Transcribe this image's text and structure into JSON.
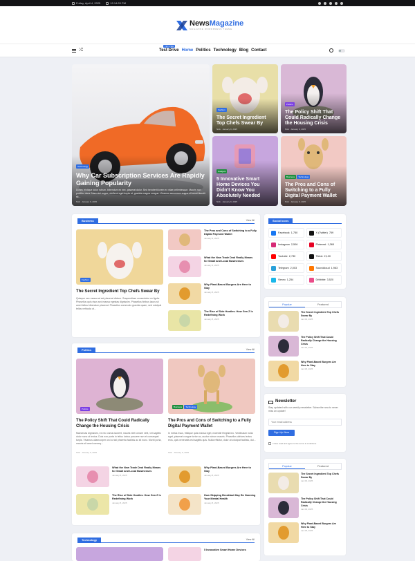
{
  "topbar": {
    "date": "Friday, April 4, 2025",
    "time": "12:14:20 PM"
  },
  "brand": {
    "name_a": "News",
    "name_b": "Magazine",
    "tagline": "MAGAZINE WORDPRESS THEME",
    "brand_color": "#2f6de1"
  },
  "nav": {
    "badge": "TRY PRO",
    "items": [
      "Test Drive",
      "Home",
      "Politics",
      "Technology",
      "Blog",
      "Contact"
    ],
    "active_index": 1
  },
  "hero": {
    "main": {
      "tag": "Technology",
      "title": "Why Car Subscription Services Are Rapidly Gaining Popularity",
      "excerpt": "Donec tristique dolor rutrum, bibendum ex nec, placerat dolor. Sed hendrerit lorem ex vitae pellentesque. Mauris non porttitor risus. Nam nisi augue, eleifend eget turpis ut, gravida magna congue. Vivamus accumsan augue sit amet blandit sit...",
      "meta": "Nick  ·  January 9, 2025"
    },
    "cards": [
      {
        "tag": "Fashion",
        "title": "The Secret Ingredient Top Chefs Swear By",
        "meta": "Nick  ·  January 9, 2025"
      },
      {
        "tag": "Politics",
        "title": "The Policy Shift That Could Radically Change the Housing Crisis",
        "meta": "Nick  ·  January 9, 2025"
      },
      {
        "tag": "Gadgets",
        "title": "5 Innovative Smart Home Devices You Didn't Know You Absolutely Needed",
        "meta": "Nick  ·  January 9, 2025"
      },
      {
        "tag1": "Business",
        "tag2": "Technology",
        "title": "The Pros and Cons of Switching to a Fully Digital Payment Wallet",
        "meta": "Nick  ·  January 9, 2025"
      }
    ]
  },
  "business": {
    "label": "Business",
    "view_all": "View All",
    "main": {
      "tag": "Fashion",
      "title": "The Secret Ingredient Top Chefs Swear By",
      "excerpt": "Quisque nec massa at est placerat dictum. Suspendisse consectetur ex ligula. Phasellus quis risus sed massa egestas dignissim. Phasellus finibus lacus sit amet tellus bibendum placerat. Phasellus commodo gravida quam, sed volutpat tellus vehicula ut..."
    },
    "list": [
      {
        "title": "The Pros and Cons of Switching to a Fully Digital Payment Wallet",
        "meta": "January 9, 2025"
      },
      {
        "title": "What the New Trade Deal Really Means for Small and Local Businesses",
        "meta": "January 9, 2025"
      },
      {
        "title": "Why Plant-Based Burgers Are Here to Stay",
        "meta": "January 8, 2025"
      },
      {
        "title": "The Rise of Side Hustles: How Gen Z Is Redefining Work",
        "meta": "January 8, 2025"
      }
    ]
  },
  "politics": {
    "label": "Politics",
    "view_all": "View All",
    "left": {
      "tag": "Politics",
      "title": "The Policy Shift That Could Radically Change the Housing Crisis",
      "excerpt": "Maecenas dignissim, ex nec varius laoreet, mauris nibh ornare velit, vel sagittis dolor nunc ut lectus. Duis non porta in tellus luctus posuere non et consequat turpis. Vivamus ullamcorper orci a nisl pharetra facilisis ac sit nunc. Morbi porta, mauris sit amet conseq...",
      "meta": "Nick  ·  January 9, 2025"
    },
    "right": {
      "tag1": "Business",
      "tag2": "Technology",
      "title": "The Pros and Cons of Switching to a Fully Digital Payment Wallet",
      "excerpt": "In metus risus, tristique quis massa eget, molestie fringilla leo. Vestibulum nulla eget, placerat congue tortor ac, auctor rutrum mauris. Phasellus ultrices lectus eros, quis venenatis est sagittis quis. Nulla efficitur, dolor at volutpat facilisis, dui...",
      "meta": "Nick  ·  January 9, 2025"
    },
    "list": [
      {
        "title": "What the New Trade Deal Really Means for Small and Local Businesses",
        "meta": "January 8, 2025"
      },
      {
        "title": "Why Plant-Based Burgers Are Here to Stay",
        "meta": "January 8, 2025"
      },
      {
        "title": "The Rise of Side Hustles: How Gen Z Is Redefining Work",
        "meta": "January 8, 2025"
      },
      {
        "title": "How Skipping Breakfast May Be Harming Your Mental Health",
        "meta": "January 8, 2025"
      }
    ]
  },
  "technology": {
    "label": "Technology",
    "view_all": "View All",
    "peek_title": "5 Innovative Smart Home Devices"
  },
  "social": {
    "label": "Social Icons",
    "items": [
      {
        "name": "Facebook",
        "count": "1,750",
        "color": "#1877f2"
      },
      {
        "name": "X (Twitter)",
        "count": "759",
        "color": "#111111"
      },
      {
        "name": "Instagram",
        "count": "2,506",
        "color": "#d62976"
      },
      {
        "name": "Pinterest",
        "count": "1,365",
        "color": "#e60023"
      },
      {
        "name": "Youtube",
        "count": "2,730",
        "color": "#ff0000"
      },
      {
        "name": "Tiktok",
        "count": "2,100",
        "color": "#111111"
      },
      {
        "name": "Telegram",
        "count": "2,003",
        "color": "#2aa1da"
      },
      {
        "name": "Soundcloud",
        "count": "1,963",
        "color": "#ff7700"
      },
      {
        "name": "Vimeo",
        "count": "1,254",
        "color": "#1ab7ea"
      },
      {
        "name": "Dribbble",
        "count": "3,520",
        "color": "#ea4c89"
      }
    ]
  },
  "widget1": {
    "tabs": [
      "Popular",
      "Featured"
    ],
    "items": [
      {
        "title": "The Secret Ingredient Top Chefs Swear By",
        "meta": "Jan 09, 2025"
      },
      {
        "title": "The Policy Shift That Could Radically Change the Housing Crisis",
        "meta": "Jan 09, 2025"
      },
      {
        "title": "Why Plant-Based Burgers Are Here to Stay",
        "meta": "Jan 08, 2025"
      }
    ]
  },
  "newsletter": {
    "title": "Newsletter",
    "text": "Stay updated with our weekly newsletter. Subscribe now to never miss an update!",
    "placeholder": "Your email address",
    "button": "Sign Up Now",
    "consent": "I have read and agree to the terms & conditions"
  },
  "widget2": {
    "tabs": [
      "Popular",
      "Featured"
    ],
    "items": [
      {
        "title": "The Secret Ingredient Top Chefs Swear By",
        "meta": "Jan 09, 2025"
      },
      {
        "title": "The Policy Shift That Could Radically Change the Housing Crisis",
        "meta": "Jan 09, 2025"
      },
      {
        "title": "Why Plant-Based Burgers Are Here to Stay",
        "meta": "Jan 08, 2025"
      }
    ]
  }
}
